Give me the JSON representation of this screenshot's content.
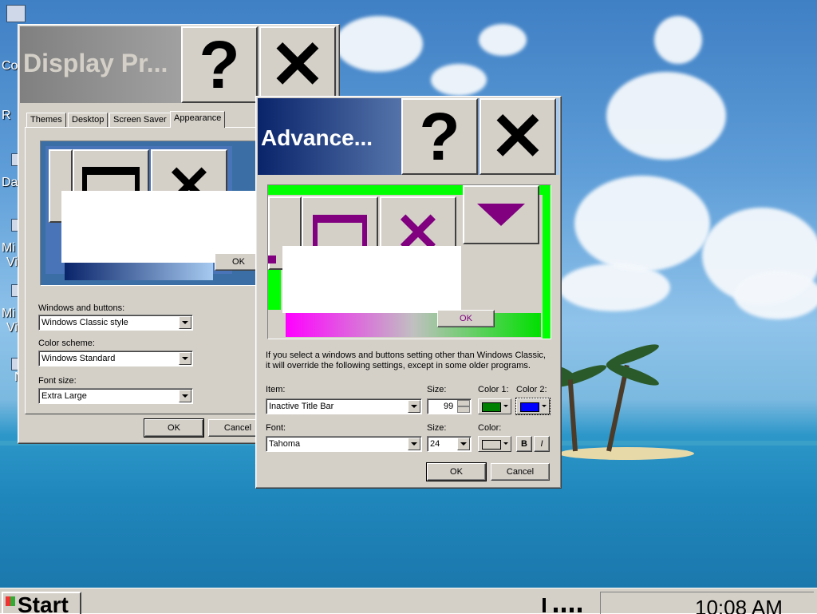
{
  "desktop": {
    "icons": [
      {
        "label": "Co",
        "icon": "my-computer-icon"
      },
      {
        "label": "R",
        "icon": "recycle-bin-icon"
      },
      {
        "label": "Da",
        "icon": "shortcut-icon"
      },
      {
        "label": "Mi",
        "label2": "Vi",
        "icon": "shortcut-icon"
      },
      {
        "label": "Mi",
        "label2": "Vi",
        "icon": "shortcut-icon"
      },
      {
        "label": "N",
        "icon": "shortcut-icon"
      }
    ]
  },
  "display_properties": {
    "title": "Display Pr...",
    "help_glyph": "?",
    "close_glyph": "✕",
    "tabs": [
      "Themes",
      "Desktop",
      "Screen Saver",
      "Appearance"
    ],
    "active_tab": "Appearance",
    "preview": {
      "ok_label": "OK"
    },
    "windows_and_buttons": {
      "label": "Windows and buttons:",
      "value": "Windows Classic style"
    },
    "color_scheme": {
      "label": "Color scheme:",
      "value": "Windows Standard"
    },
    "font_size": {
      "label": "Font size:",
      "value": "Extra Large"
    },
    "ok_label": "OK",
    "cancel_label": "Cancel"
  },
  "advanced": {
    "title": "Advance...",
    "help_glyph": "?",
    "close_glyph": "✕",
    "preview": {
      "ok_label": "OK"
    },
    "info_text_line1": "If you select a windows and buttons setting other than Windows Classic,",
    "info_text_line2": "it will override the following settings, except in some older programs.",
    "item": {
      "label": "Item:",
      "value": "Inactive Title Bar"
    },
    "item_size": {
      "label": "Size:",
      "value": "99"
    },
    "color1": {
      "label": "Color 1:",
      "color": "#008000"
    },
    "color2": {
      "label": "Color 2:",
      "color": "#0000ff"
    },
    "font": {
      "label": "Font:",
      "value": "Tahoma"
    },
    "font_size": {
      "label": "Size:",
      "value": "24"
    },
    "font_color": {
      "label": "Color:",
      "color": "#d4d0c8"
    },
    "bold_label": "B",
    "italic_label": "I",
    "ok_label": "OK",
    "cancel_label": "Cancel"
  },
  "taskbar": {
    "start_label": "Start",
    "clock": "10:08 AM"
  },
  "colors": {
    "classic_gray": "#d4d0c8",
    "active_title_start": "#0a246a",
    "active_title_end": "#a6caf0",
    "inactive_title": "#808080",
    "preview_green": "#00ff00",
    "preview_magenta": "#ff00ff",
    "preview_purple": "#800080"
  }
}
